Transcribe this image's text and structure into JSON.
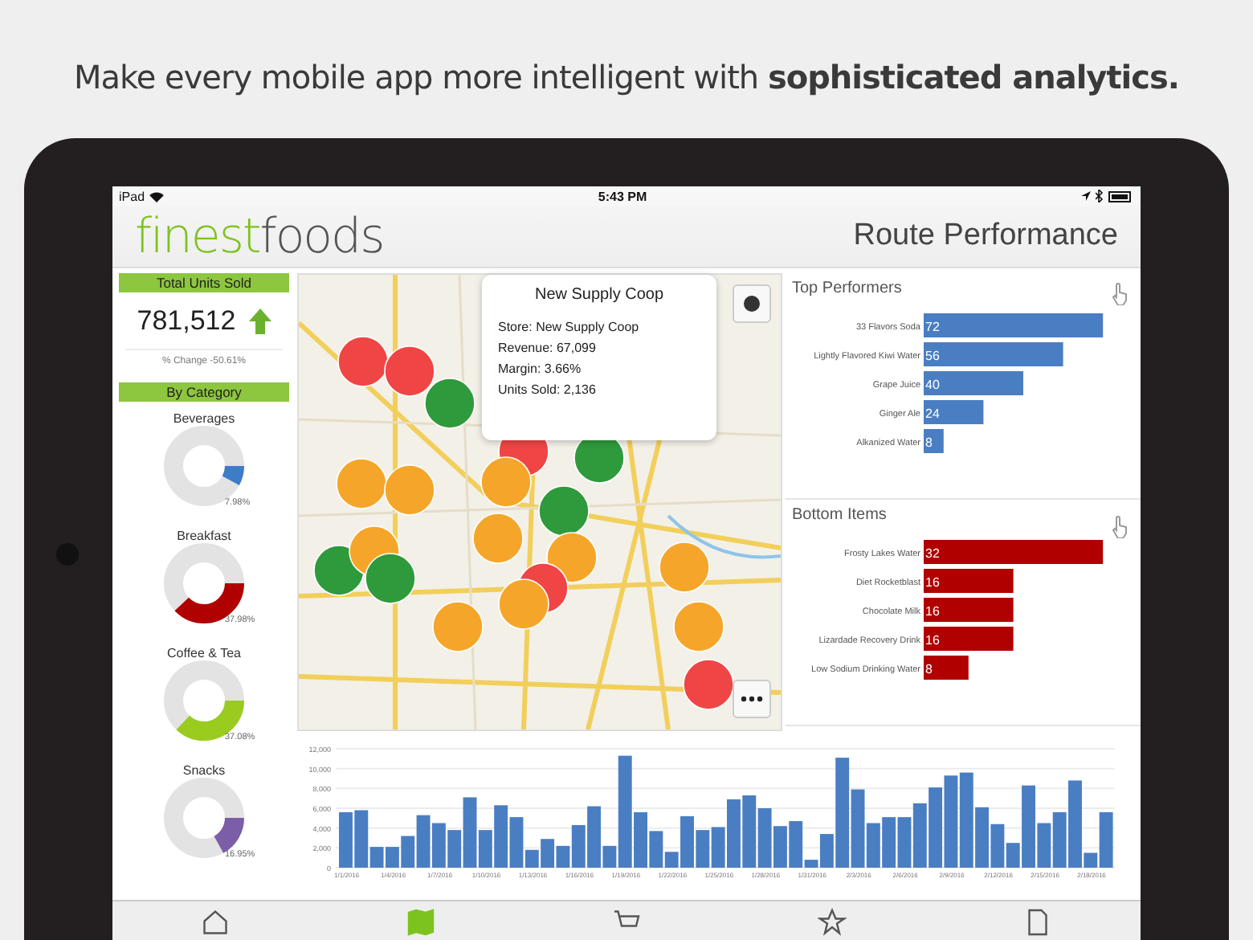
{
  "headline": "Make every mobile app more intelligent with **sophisticated analytics.**",
  "status_bar": {
    "device": "iPad",
    "time": "5:43 PM"
  },
  "header": {
    "logo_first": "finest",
    "logo_second": "foods",
    "title": "Route Performance"
  },
  "sidebar": {
    "total_header": "Total Units Sold",
    "total_value": "781,512",
    "change": "% Change -50.61%",
    "category_header": "By Category",
    "categories": [
      {
        "name": "Beverages",
        "level": 0.0798,
        "reading": "7.98%",
        "color": "#3d7cc9"
      },
      {
        "name": "Breakfast",
        "level": 0.3798,
        "reading": "37.98%",
        "color": "#b00000"
      },
      {
        "name": "Coffee & Tea",
        "level": 0.3708,
        "reading": "37.08%",
        "color": "#99cc1f"
      },
      {
        "name": "Snacks",
        "level": 0.1695,
        "reading": "16.95%",
        "color": "#7b5ea7"
      }
    ]
  },
  "map": {
    "markers": [
      {
        "color": "#f04545"
      },
      {
        "color": "#f04545"
      },
      {
        "color": "#2f9a3c"
      },
      {
        "color": "#f04545"
      },
      {
        "color": "#2f9a3c"
      },
      {
        "color": "#f5a62a"
      },
      {
        "color": "#f5a62a"
      },
      {
        "color": "#f5a62a"
      },
      {
        "color": "#2f9a3c"
      },
      {
        "color": "#f5a62a"
      },
      {
        "color": "#f5a62a"
      },
      {
        "color": "#2f9a3c"
      },
      {
        "color": "#f5a62a"
      },
      {
        "color": "#2f9a3c"
      },
      {
        "color": "#f04545"
      },
      {
        "color": "#f5a62a"
      },
      {
        "color": "#f5a62a"
      },
      {
        "color": "#f5a62a"
      },
      {
        "color": "#f5a62a"
      },
      {
        "color": "#f04545"
      }
    ],
    "popup": {
      "title": "New Supply Coop",
      "rows": [
        {
          "label": "Store:",
          "value": "New Supply Coop"
        },
        {
          "label": "Revenue:",
          "value": "67,099"
        },
        {
          "label": "Margin:",
          "value": "3.66%"
        },
        {
          "label": "Units Sold:",
          "value": "2,136"
        }
      ]
    }
  },
  "top_performers": {
    "title": "Top Performers",
    "chart_data": {
      "type": "bar",
      "orientation": "horizontal",
      "data_labels": true,
      "categories": [
        "33 Flavors Soda",
        "Lightly Flavored Kiwi Water",
        "Grape Juice",
        "Ginger Ale",
        "Alkanized Water"
      ],
      "series": [
        {
          "color": "#4a7ec2",
          "values": [
            72,
            56,
            40,
            24,
            8
          ]
        }
      ]
    }
  },
  "bottom_items": {
    "title": "Bottom Items",
    "chart_data": {
      "type": "bar",
      "orientation": "horizontal",
      "data_labels": true,
      "categories": [
        "Frosty Lakes Water",
        "Diet Rocketblast",
        "Chocolate Milk",
        "Lizardade Recovery Drink",
        "Low Sodium Drinking Water"
      ],
      "series": [
        {
          "color": "#b00000",
          "values": [
            32,
            16,
            16,
            16,
            8
          ]
        }
      ]
    }
  },
  "timeline": {
    "chart_data": {
      "type": "bar",
      "ylim": [
        0,
        12000
      ],
      "grid": true,
      "categories": [
        "1/1/2016",
        null,
        null,
        "1/4/2016",
        null,
        null,
        "1/7/2016",
        null,
        null,
        "1/10/2016",
        null,
        null,
        "1/13/2016",
        null,
        null,
        "1/16/2016",
        null,
        null,
        "1/19/2016",
        null,
        null,
        "1/22/2016",
        null,
        null,
        "1/25/2016",
        null,
        null,
        "1/28/2016",
        null,
        null,
        "1/31/2016",
        null,
        null,
        "2/3/2016",
        null,
        null,
        "2/6/2016",
        null,
        null,
        "2/9/2016",
        null,
        null,
        "2/12/2016",
        null,
        null,
        "2/15/2016",
        null,
        null,
        "2/18/2016",
        null
      ],
      "yticks": [
        {
          "value": 0,
          "label": "0"
        },
        {
          "value": 2000,
          "label": "2,000"
        },
        {
          "value": 4000,
          "label": "4,000"
        },
        {
          "value": 6000,
          "label": "6,000"
        },
        {
          "value": 8000,
          "label": "8,000"
        },
        {
          "value": 10000,
          "label": "10,000"
        },
        {
          "value": 12000,
          "label": "12,000"
        }
      ],
      "series": [
        {
          "color": "#4a7ec2",
          "values": [
            5600,
            5800,
            2100,
            2100,
            3200,
            5300,
            4500,
            3800,
            7100,
            3800,
            6300,
            5100,
            1800,
            2900,
            2200,
            4300,
            6200,
            2200,
            11300,
            5600,
            3700,
            1600,
            5200,
            3800,
            4100,
            6900,
            7300,
            6000,
            4200,
            4700,
            800,
            3400,
            11100,
            7900,
            4500,
            5100,
            5100,
            6500,
            8100,
            9300,
            9600,
            6100,
            4400,
            2500,
            8300,
            4500,
            5600,
            8800,
            1500,
            5600
          ]
        }
      ]
    }
  },
  "tabs": [
    {
      "kind": "home",
      "selected": false
    },
    {
      "kind": "map",
      "selected": true
    },
    {
      "kind": "cart",
      "selected": false
    },
    {
      "kind": "star",
      "selected": false
    },
    {
      "kind": "document",
      "selected": false
    }
  ]
}
